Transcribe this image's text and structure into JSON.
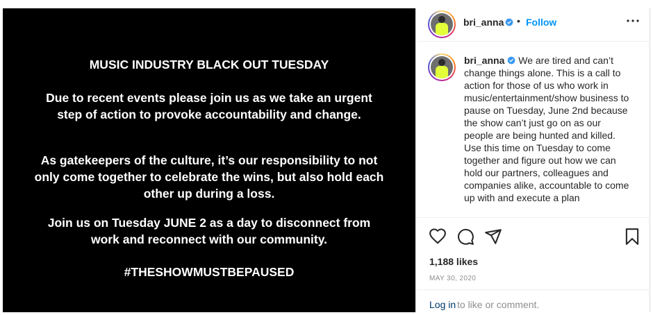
{
  "image": {
    "title": "MUSIC INDUSTRY BLACK OUT TUESDAY",
    "paragraph1": "Due to recent events please join us as we take an urgent step of action to provoke accountability and change.",
    "paragraph2": "As gatekeepers of the culture, it’s our responsibility to not only come together to celebrate the wins, but also hold each other up during a loss.",
    "paragraph3": "Join us on Tuesday JUNE 2 as a day to disconnect from work and reconnect with our community.",
    "hashtag": "#THESHOWMUSTBEPAUSED"
  },
  "header": {
    "username": "bri_anna",
    "separator": "•",
    "follow_label": "Follow",
    "more_icon": "more-horizontal-icon",
    "verified_icon": "verified-badge-icon"
  },
  "caption": {
    "username": "bri_anna",
    "text": " We are tired and can’t change things alone. This is a call to action for those of us who work in music/entertainment/show business to pause on Tuesday, June 2nd because the show can’t just go on as our people are being hunted and killed.\nUse this time on Tuesday to come together and figure out how we can hold our partners, colleagues and companies alike, accountable to come up with and execute a plan"
  },
  "actions": {
    "like_icon": "heart-icon",
    "comment_icon": "comment-icon",
    "share_icon": "send-icon",
    "save_icon": "bookmark-icon"
  },
  "stats": {
    "likes": "1,188 likes",
    "date": "MAY 30, 2020"
  },
  "comment_bar": {
    "login_label": "Log in",
    "rest_text": " to like or comment."
  },
  "colors": {
    "accent": "#0095f6",
    "verified": "#3897f0",
    "image_bg": "#000000"
  }
}
